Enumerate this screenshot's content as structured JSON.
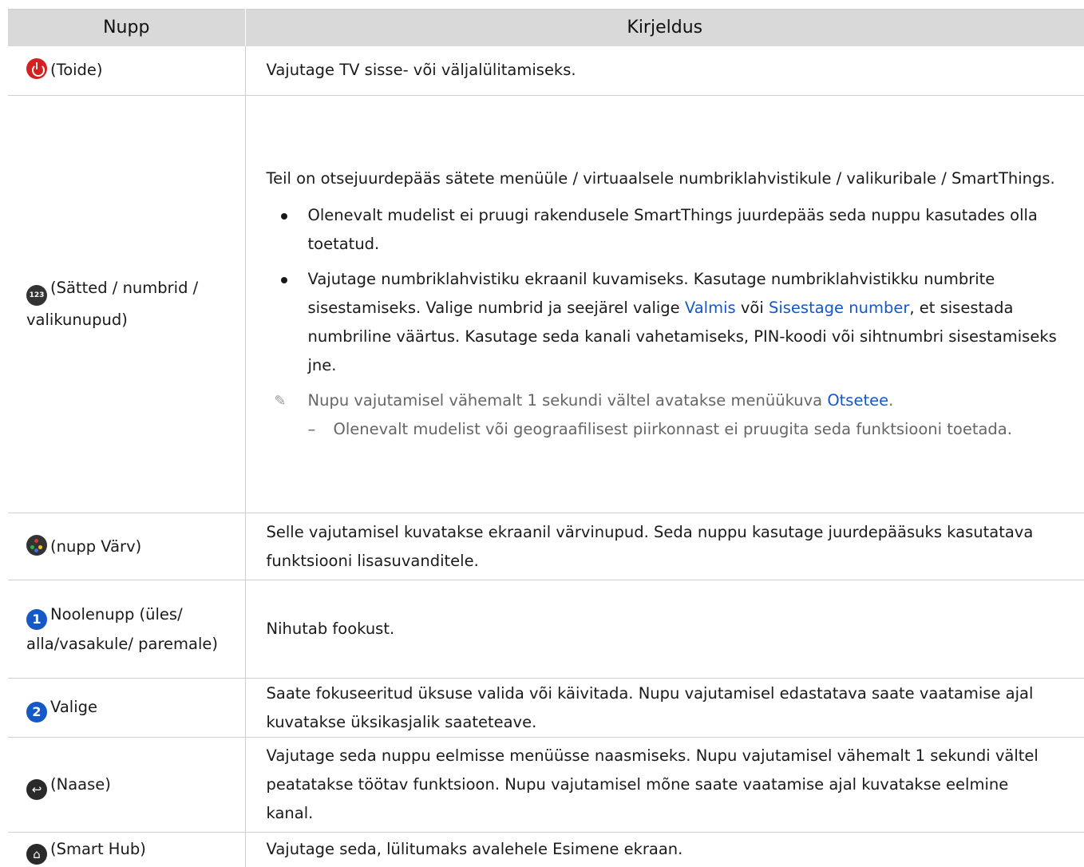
{
  "headers": {
    "col1": "Nupp",
    "col2": "Kirjeldus"
  },
  "rows": [
    {
      "key": "(Toide)",
      "icon": "power-icon",
      "desc": "Vajutage TV sisse- või väljalülitamiseks."
    },
    {
      "key": "(Sätted / numbrid / valikunupud)",
      "icon": "settings-number-icon",
      "icon_glyph": "123",
      "intro": "Teil on otsejuurdepääs sätete menüüle / virtuaalsele numbriklahvistikule / valikuribale / SmartThings.",
      "bullet1": "Olenevalt mudelist ei pruugi rakendusele SmartThings juurdepääs seda nuppu kasutades olla toetatud.",
      "bullet2_a": "Vajutage numbriklahvistiku ekraanil kuvamiseks. Kasutage numbriklahvistikku numbrite sisestamiseks. Valige numbrid ja seejärel valige ",
      "bullet2_link1": "Valmis",
      "bullet2_b": " või ",
      "bullet2_link2": "Sisestage number",
      "bullet2_c": ", et sisestada numbriline väärtus. Kasutage seda kanali vahetamiseks, PIN-koodi või sihtnumbri sisestamiseks jne.",
      "note_a": "Nupu vajutamisel vähemalt 1 sekundi vältel avatakse menüükuva ",
      "note_link": "Otsetee",
      "note_b": ".",
      "sub": "Olenevalt mudelist või geograafilisest piirkonnast ei pruugita seda funktsiooni toetada."
    },
    {
      "key": "(nupp Värv)",
      "icon": "color-buttons-icon",
      "desc": "Selle vajutamisel kuvatakse ekraanil värvinupud. Seda nuppu kasutage juurdepääsuks kasutatava funktsiooni lisasuvanditele."
    },
    {
      "key": "Noolenupp (üles/ alla/vasakule/ paremale)",
      "icon": "number-1-icon",
      "icon_glyph": "1",
      "desc": "Nihutab fookust."
    },
    {
      "key": "Valige",
      "icon": "number-2-icon",
      "icon_glyph": "2",
      "desc": "Saate fokuseeritud üksuse valida või käivitada. Nupu vajutamisel edastatava saate vaatamise ajal kuvatakse üksikasjalik saateteave."
    },
    {
      "key": "(Naase)",
      "icon": "back-icon",
      "icon_glyph": "↩",
      "desc": "Vajutage seda nuppu eelmisse menüüsse naasmiseks. Nupu vajutamisel vähemalt 1 sekundi vältel peatatakse töötav funktsioon. Nupu vajutamisel mõne saate vaatamise ajal kuvatakse eelmine kanal."
    },
    {
      "key": "(Smart Hub)",
      "icon": "home-icon",
      "icon_glyph": "⌂",
      "desc": "Vajutage seda, lülitumaks avalehele Esimene ekraan."
    }
  ],
  "colors": {
    "header_bg": "#d9d9d9",
    "link": "#1458c8",
    "power": "#d42020",
    "badge": "#1559c6"
  }
}
